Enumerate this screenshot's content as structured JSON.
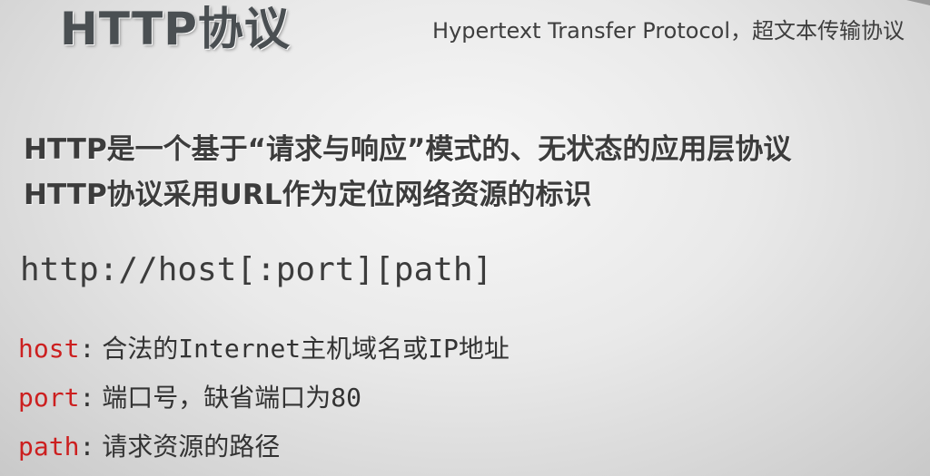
{
  "header": {
    "title": "HTTP协议",
    "subtitle": "Hypertext Transfer Protocol，超文本传输协议"
  },
  "intro": {
    "lines": [
      "HTTP是一个基于“请求与响应”模式的、无状态的应用层协议",
      "HTTP协议采用URL作为定位网络资源的标识"
    ]
  },
  "syntax": "http://host[:port][path]",
  "definitions": [
    {
      "term": "host",
      "separator": ":",
      "description": "合法的Internet主机域名或IP地址"
    },
    {
      "term": "port",
      "separator": ":",
      "description": "端口号，缺省端口为80"
    },
    {
      "term": "path",
      "separator": ":",
      "description": "请求资源的路径"
    }
  ],
  "colors": {
    "term": "#cc1f1f",
    "text": "#3c3c3c",
    "title": "#4a4f52"
  }
}
